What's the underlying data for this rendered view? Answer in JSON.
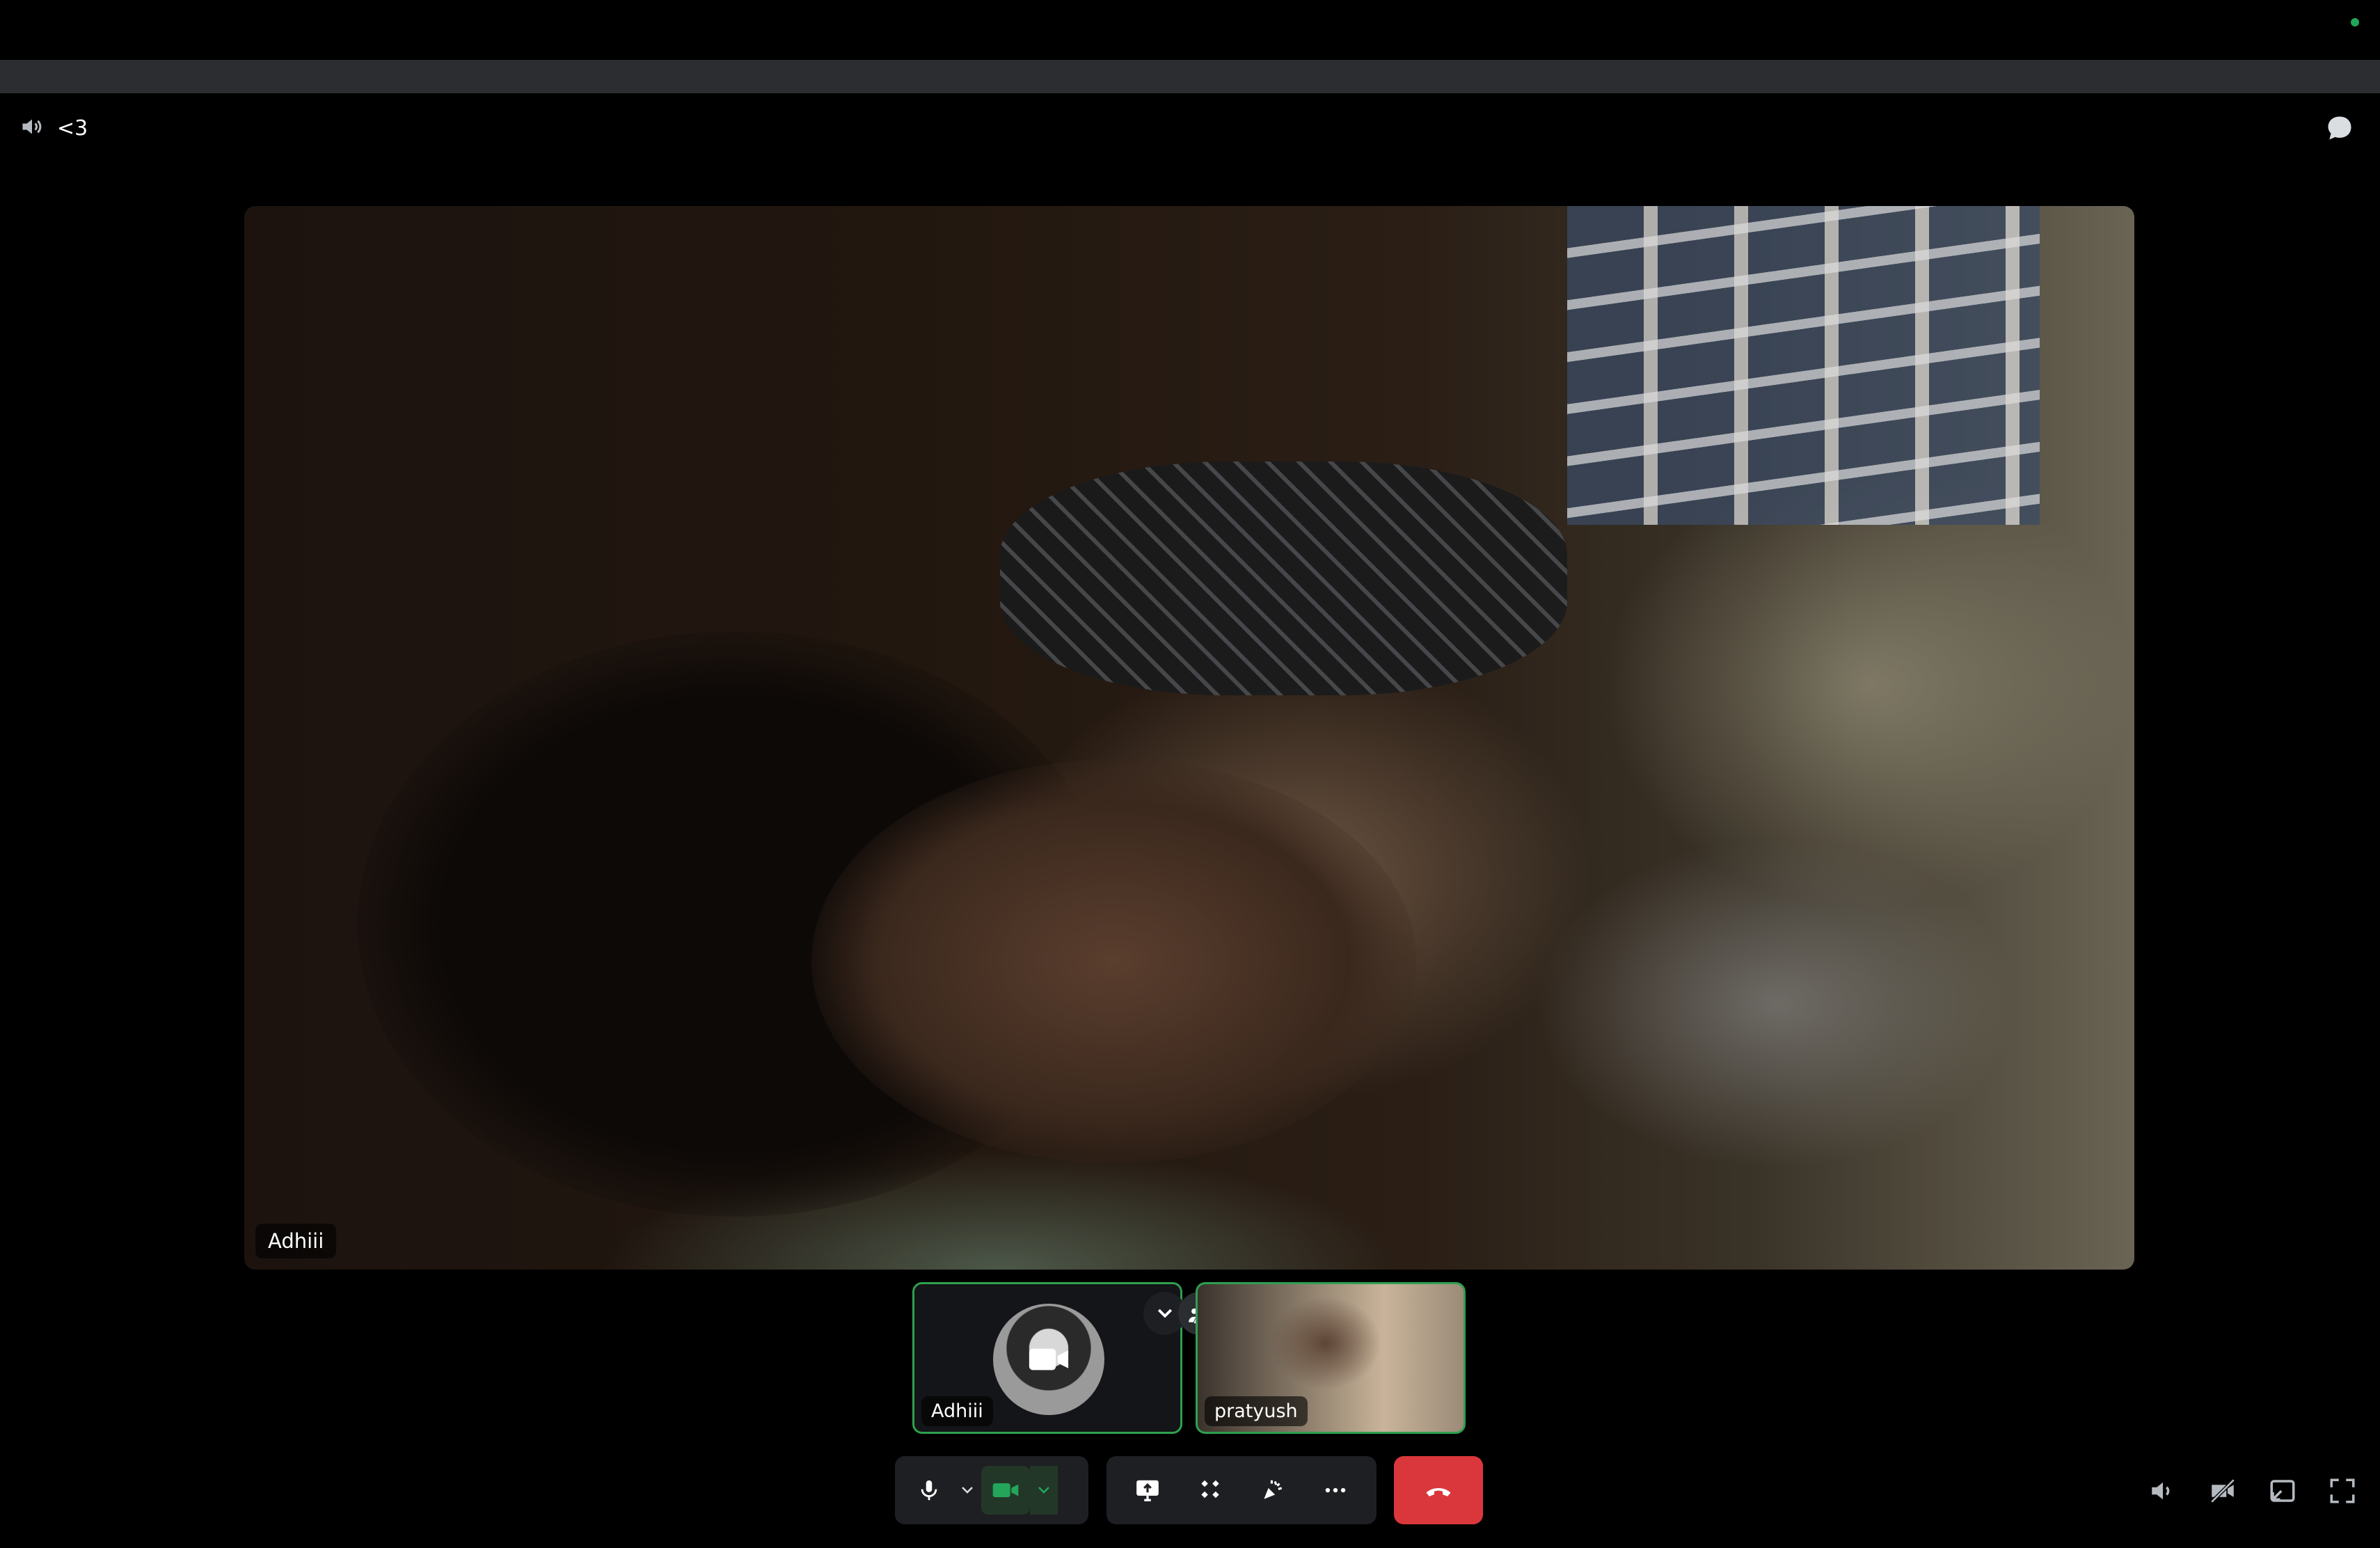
{
  "header": {
    "channel_name": "<3",
    "icons": {
      "volume": "speaker-icon",
      "chat": "chat-bubble-icon"
    }
  },
  "main_stage": {
    "participant_name": "Adhiii"
  },
  "participants": [
    {
      "name": "Adhiii",
      "camera": "off",
      "avatar": "anime-avatar",
      "speaking_border_color": "#2ea04f"
    },
    {
      "name": "pratyush",
      "camera": "on",
      "speaking_border_color": "#2ea04f"
    }
  ],
  "tile_actions": {
    "icons": [
      "chevron-down-icon",
      "people-icon"
    ]
  },
  "controls": {
    "microphone": {
      "icon": "microphone-icon",
      "state": "on"
    },
    "camera": {
      "icon": "camera-icon",
      "state": "on",
      "accent": "#23a55a"
    },
    "screen_share": {
      "icon": "screen-share-icon"
    },
    "activities": {
      "icon": "activities-icon"
    },
    "soundboard": {
      "icon": "soundboard-icon"
    },
    "more": {
      "icon": "more-icon"
    },
    "disconnect": {
      "icon": "hang-up-icon",
      "color": "#da373c"
    }
  },
  "right_tools": {
    "icons": [
      "volume-icon",
      "video-off-icon",
      "pop-out-icon",
      "fullscreen-icon"
    ]
  },
  "status": {
    "online_color": "#23a55a"
  }
}
